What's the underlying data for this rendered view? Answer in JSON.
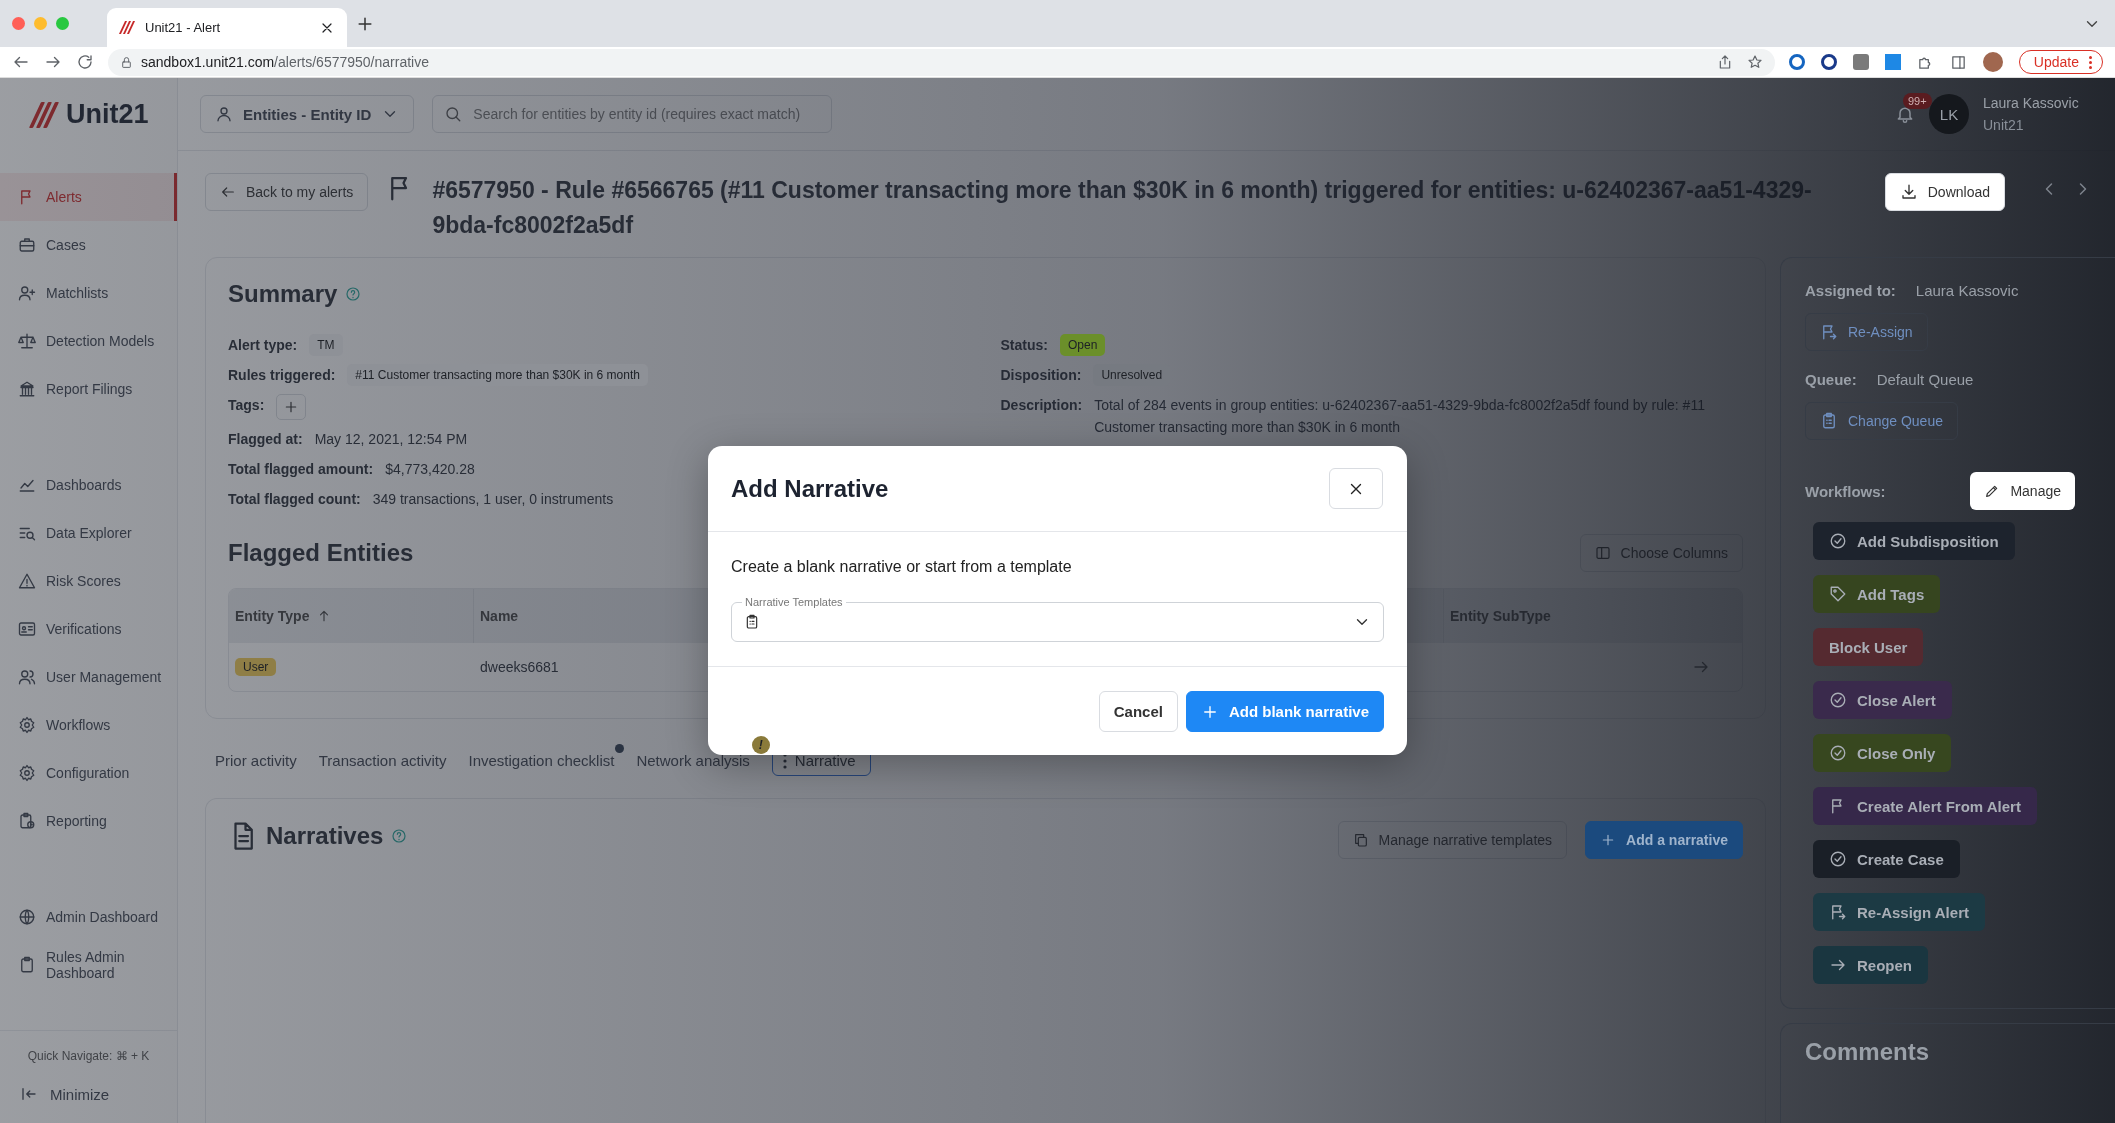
{
  "browser": {
    "tab_title": "Unit21 - Alert",
    "url_host": "sandbox1.unit21.com",
    "url_path": "/alerts/6577950/narrative",
    "update_button": "Update"
  },
  "sidebar": {
    "logo": "Unit21",
    "groups": [
      [
        {
          "label": "Alerts",
          "selected": true
        },
        {
          "label": "Cases",
          "selected": false
        },
        {
          "label": "Matchlists",
          "selected": false
        },
        {
          "label": "Detection Models",
          "selected": false
        },
        {
          "label": "Report Filings",
          "selected": false
        }
      ],
      [
        {
          "label": "Dashboards",
          "selected": false
        },
        {
          "label": "Data Explorer",
          "selected": false
        },
        {
          "label": "Risk Scores",
          "selected": false
        },
        {
          "label": "Verifications",
          "selected": false
        },
        {
          "label": "User Management",
          "selected": false
        },
        {
          "label": "Workflows",
          "selected": false
        },
        {
          "label": "Configuration",
          "selected": false
        },
        {
          "label": "Reporting",
          "selected": false
        }
      ],
      [
        {
          "label": "Admin Dashboard",
          "selected": false
        },
        {
          "label": "Rules Admin Dashboard",
          "selected": false
        }
      ]
    ],
    "quick_navigate": "Quick Navigate: ⌘ + K",
    "minimize": "Minimize"
  },
  "header": {
    "entity_select": "Entities - Entity ID",
    "search_placeholder": "Search for entities by entity id (requires exact match)",
    "notification_badge": "99+",
    "avatar": "LK",
    "user_name": "Laura Kassovic",
    "org": "Unit21"
  },
  "alert": {
    "back": "Back to my alerts",
    "title": "#6577950 - Rule #6566765 (#11 Customer transacting more than $30K in 6 month) triggered for entities: u-62402367-aa51-4329-9bda-fc8002f2a5df",
    "download": "Download"
  },
  "summary": {
    "title": "Summary",
    "left": [
      {
        "label": "Alert type:",
        "kind": "tag",
        "value": "TM",
        "color": "#8e9197"
      },
      {
        "label": "Rules triggered:",
        "kind": "tag",
        "value": "#11 Customer transacting more than $30K in 6 month",
        "color": "#8e9197"
      },
      {
        "label": "Tags:",
        "kind": "add"
      },
      {
        "label": "Flagged at:",
        "kind": "text",
        "value": "May 12, 2021, 12:54 PM"
      },
      {
        "label": "Total flagged amount:",
        "kind": "text",
        "value": "$4,773,420.28"
      },
      {
        "label": "Total flagged count:",
        "kind": "text",
        "value": "349 transactions, 1 user, 0 instruments"
      }
    ],
    "right": [
      {
        "label": "Status:",
        "kind": "tag",
        "value": "Open",
        "color": "#6b8f2a"
      },
      {
        "label": "Disposition:",
        "kind": "tag",
        "value": "Unresolved",
        "color": "#767a81"
      },
      {
        "label": "Description:",
        "kind": "text",
        "value": "Total of 284 events in group entities: u-62402367-aa51-4329-9bda-fc8002f2a5df found by rule: #11 Customer transacting more than $30K in 6 month"
      }
    ]
  },
  "flagged_entities": {
    "title": "Flagged Entities",
    "choose_columns": "Choose Columns",
    "columns": [
      {
        "label": "Entity Type",
        "sorted": true
      },
      {
        "label": "Name",
        "sorted": false
      },
      {
        "label": "Entity SubType",
        "sorted": false
      }
    ],
    "rows": [
      {
        "entity_type": "User",
        "color": "#8f7e46",
        "name": "dweeks6681"
      }
    ]
  },
  "tabs": [
    {
      "label": "Prior activity",
      "selected": false,
      "kind": "plain"
    },
    {
      "label": "Transaction activity",
      "selected": false,
      "kind": "plain"
    },
    {
      "label": "Investigation checklist",
      "selected": false,
      "kind": "dot"
    },
    {
      "label": "Network analysis",
      "selected": false,
      "kind": "warning",
      "badge": "!"
    },
    {
      "label": "Narrative",
      "selected": true,
      "kind": "plain"
    }
  ],
  "narratives": {
    "title": "Narratives",
    "manage_templates": "Manage narrative templates",
    "add": "Add a narrative"
  },
  "right_panel": {
    "assigned_label": "Assigned to:",
    "assigned_value": "Laura Kassovic",
    "reassign": "Re-Assign",
    "queue_label": "Queue:",
    "queue_value": "Default Queue",
    "change_queue": "Change Queue",
    "workflows_label": "Workflows:",
    "manage": "Manage",
    "workflows": [
      {
        "label": "Add Subdisposition",
        "kind": "check",
        "color": "#1d232d"
      },
      {
        "label": "Add Tags",
        "kind": "tag",
        "color": "#36451f"
      },
      {
        "label": "Block User",
        "kind": "plain",
        "color": "#552a30"
      },
      {
        "label": "Close Alert",
        "kind": "check",
        "color": "#3a2a4c"
      },
      {
        "label": "Close Only",
        "kind": "check",
        "color": "#37471f"
      },
      {
        "label": "Create Alert From Alert",
        "kind": "flag",
        "color": "#36284a"
      },
      {
        "label": "Create Case",
        "kind": "check",
        "color": "#1a1f27"
      },
      {
        "label": "Re-Assign Alert",
        "kind": "reassign",
        "color": "#1c3a44"
      },
      {
        "label": "Reopen",
        "kind": "arrow",
        "color": "#1a3640"
      }
    ],
    "comments_title": "Comments"
  },
  "modal": {
    "title": "Add Narrative",
    "prompt": "Create a blank narrative or start from a template",
    "field_label": "Narrative Templates",
    "cancel": "Cancel",
    "confirm": "Add blank narrative"
  }
}
